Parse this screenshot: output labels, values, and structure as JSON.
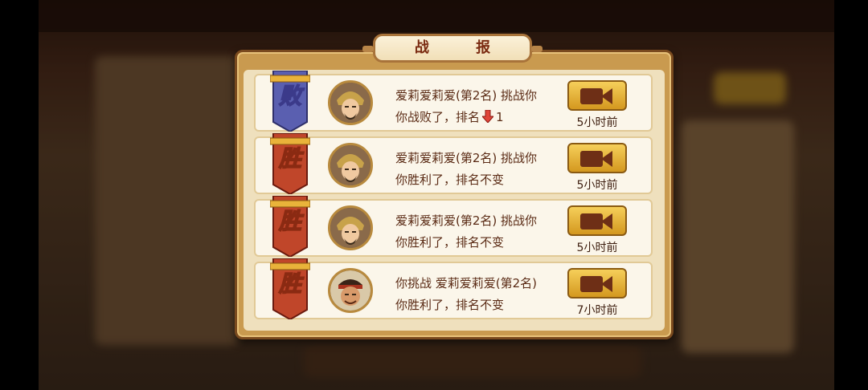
{
  "dialog": {
    "title": "战  报"
  },
  "rows": [
    {
      "result": "败",
      "result_type": "lose",
      "line1": "爱莉爱莉爱(第2名) 挑战你",
      "line2": "你战败了，排名",
      "rank_change": "1",
      "rank_arrow": "down",
      "time": "5小时前",
      "avatar": "warrior-helmet"
    },
    {
      "result": "胜",
      "result_type": "win",
      "line1": "爱莉爱莉爱(第2名) 挑战你",
      "line2": "你胜利了，排名不变",
      "time": "5小时前",
      "avatar": "warrior-helmet"
    },
    {
      "result": "胜",
      "result_type": "win",
      "line1": "爱莉爱莉爱(第2名) 挑战你",
      "line2": "你胜利了，排名不变",
      "time": "5小时前",
      "avatar": "warrior-helmet"
    },
    {
      "result": "胜",
      "result_type": "win",
      "line1": "你挑战 爱莉爱莉爱(第2名)",
      "line2": "你胜利了，排名不变",
      "time": "7小时前",
      "avatar": "warrior-headband"
    }
  ],
  "icons": {
    "replay": "video-camera-icon",
    "rank_down": "red-down-arrow-icon"
  },
  "colors": {
    "lose_banner": "#5a5fb0",
    "win_banner": "#c0462a",
    "button": "#e8b53a",
    "text": "#5a2a14"
  }
}
